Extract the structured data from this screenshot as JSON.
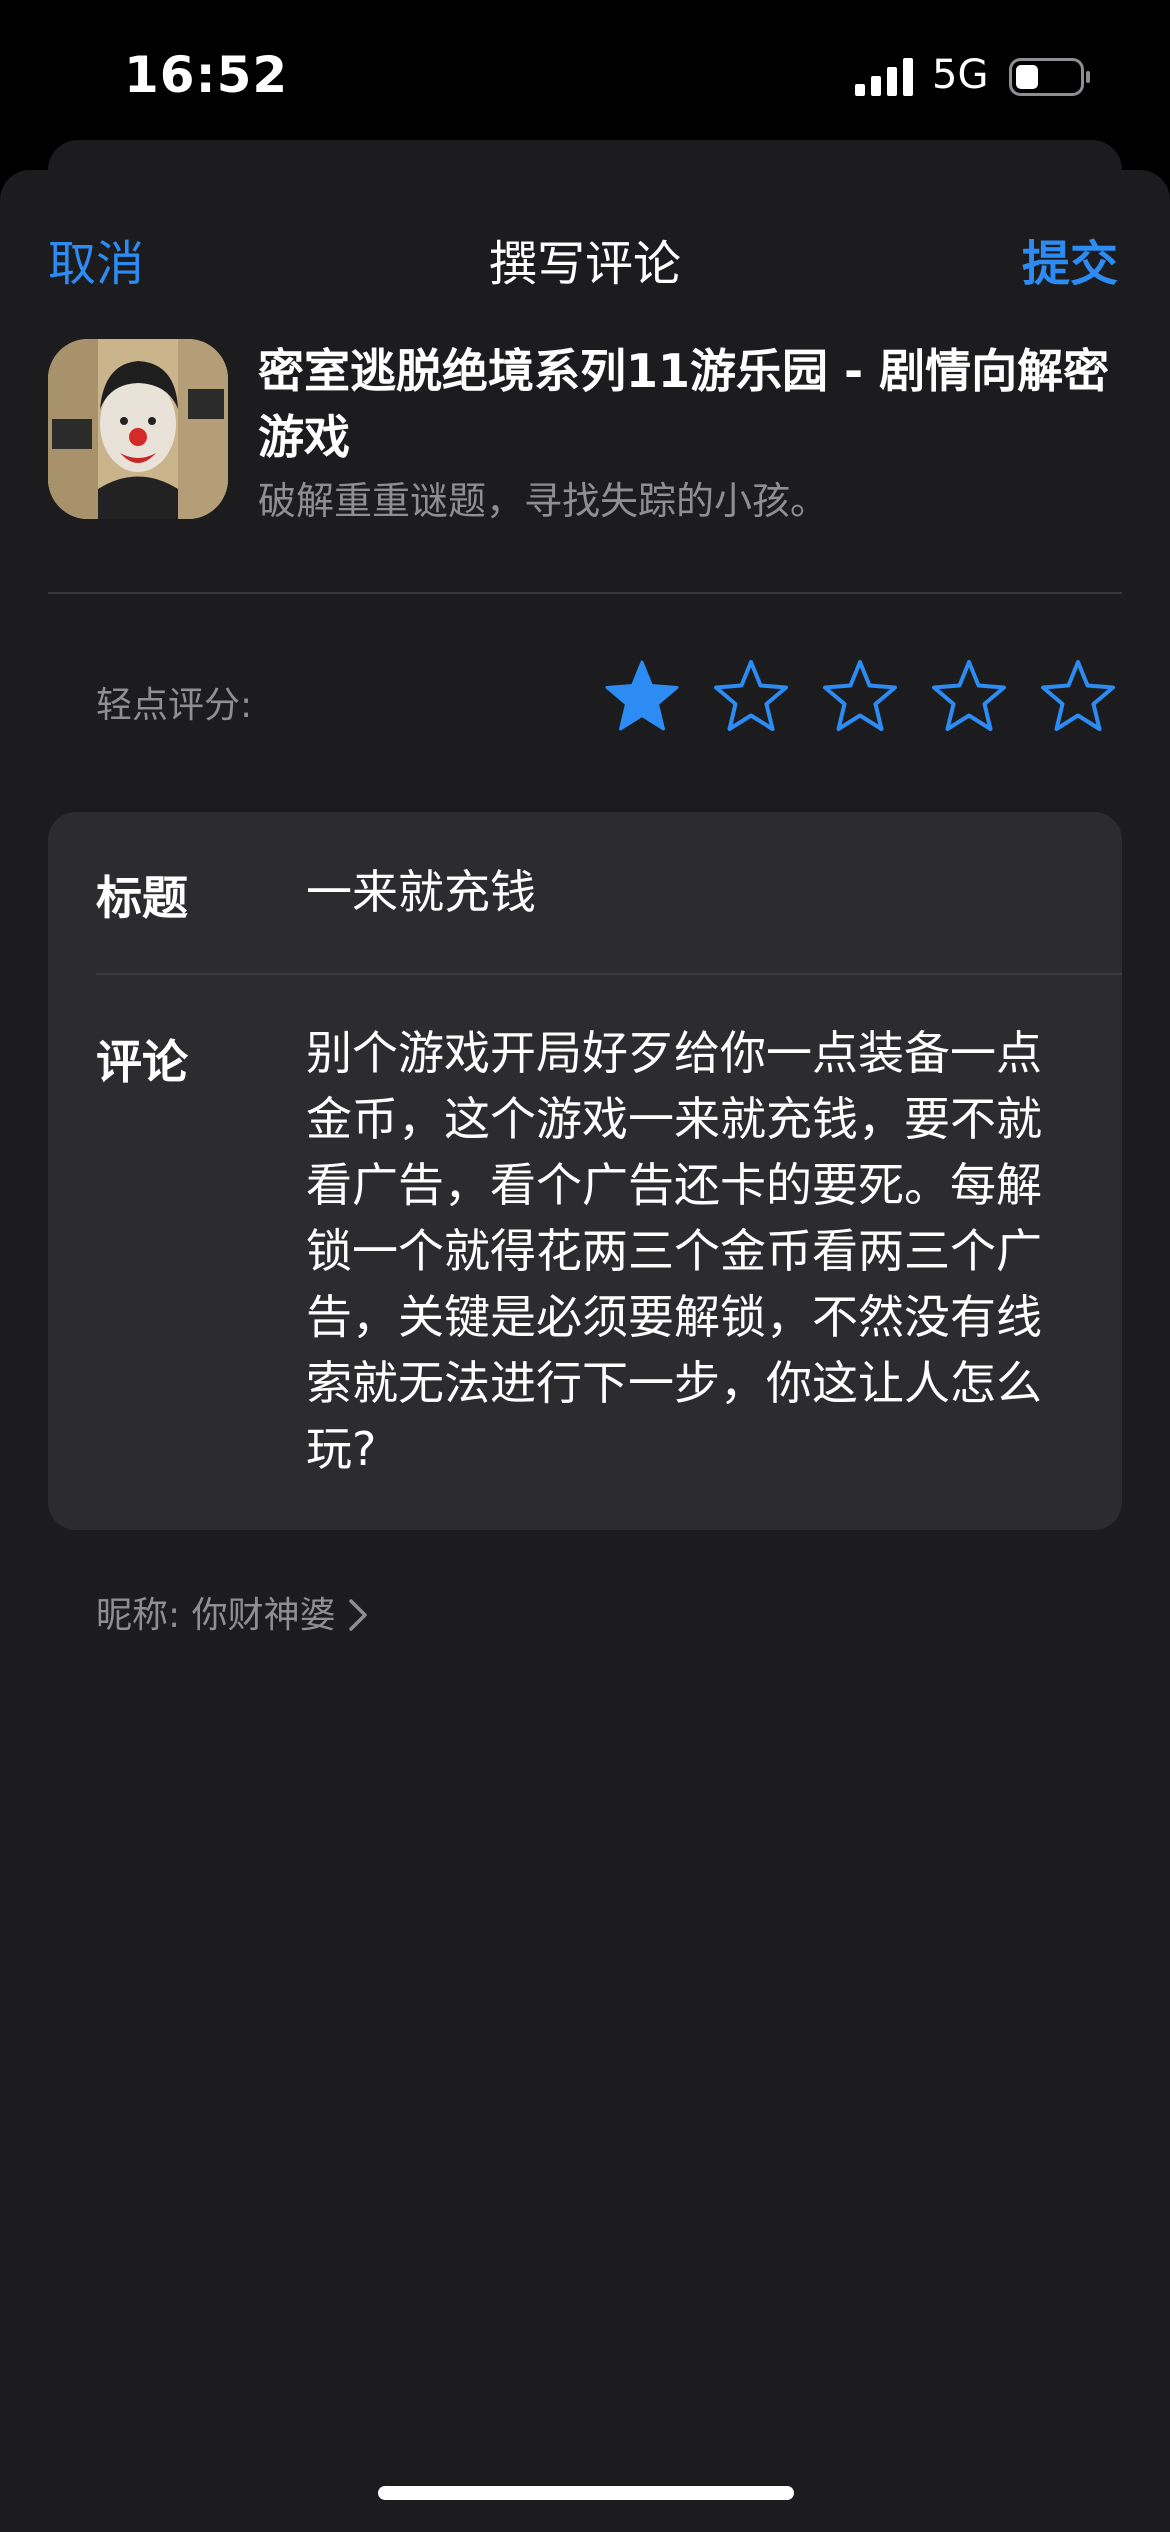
{
  "status_bar": {
    "time": "16:52",
    "network": "5G",
    "icons": [
      "signal-icon",
      "battery-icon"
    ]
  },
  "nav": {
    "cancel_label": "取消",
    "title": "撰写评论",
    "submit_label": "提交",
    "accent_color": "#2c8cf4"
  },
  "app": {
    "name": "密室逃脱绝境系列11游乐园 - 剧情向解密游戏",
    "subtitle": "破解重重谜题，寻找失踪的小孩。",
    "icon": "app-icon-clown-poster"
  },
  "rating": {
    "label": "轻点评分:",
    "value": 1,
    "max": 5,
    "star_color": "#2c8cf4"
  },
  "form": {
    "title_label": "标题",
    "title_value": "一来就充钱",
    "review_label": "评论",
    "review_value": "别个游戏开局好歹给你一点装备一点金币，这个游戏一来就充钱，要不就看广告，看个广告还卡的要死。每解锁一个就得花两三个金币看两三个广告，关键是必须要解锁，不然没有线索就无法进行下一步，你这让人怎么玩?"
  },
  "nickname": {
    "text": "昵称: 你财神婆 ",
    "icon": "chevron-right-icon"
  }
}
